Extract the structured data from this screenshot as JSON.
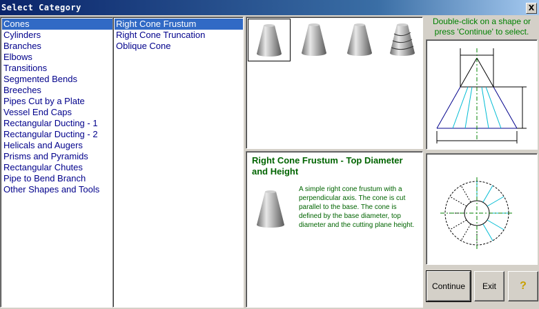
{
  "window": {
    "title": "Select Category",
    "close_label": "X"
  },
  "categories": [
    "Cones",
    "Cylinders",
    "Branches",
    "Elbows",
    "Transitions",
    "Segmented Bends",
    "Breeches",
    "Pipes Cut by a Plate",
    "Vessel End Caps",
    "Rectangular Ducting - 1",
    "Rectangular Ducting - 2",
    "Helicals and Augers",
    "Prisms and Pyramids",
    "Rectangular Chutes",
    "Pipe to Bend Branch",
    "Other Shapes and Tools"
  ],
  "selected_category": "Cones",
  "shapes": [
    "Right Cone Frustum",
    "Right Cone Truncation",
    "Oblique Cone"
  ],
  "selected_shape": "Right Cone Frustum",
  "thumbnails": [
    "cone-frustum-icon",
    "cone-frustum-icon",
    "cone-frustum-icon",
    "cone-truncation-icon"
  ],
  "hint": "Double-click on a shape or press 'Continue' to select.",
  "description": {
    "title": "Right Cone Frustum - Top Diameter and Height",
    "text": "A simple right cone frustum with a perpendicular axis. The cone is cut parallel to the base. The cone is defined by the base diameter, top diameter and the cutting plane height."
  },
  "buttons": {
    "continue": "Continue",
    "exit": "Exit",
    "help": "?"
  },
  "colors": {
    "title_bar": "#0a246a",
    "selection": "#316ac5",
    "list_text": "#00008b",
    "description_text": "#006400",
    "hint_text": "#008000"
  }
}
